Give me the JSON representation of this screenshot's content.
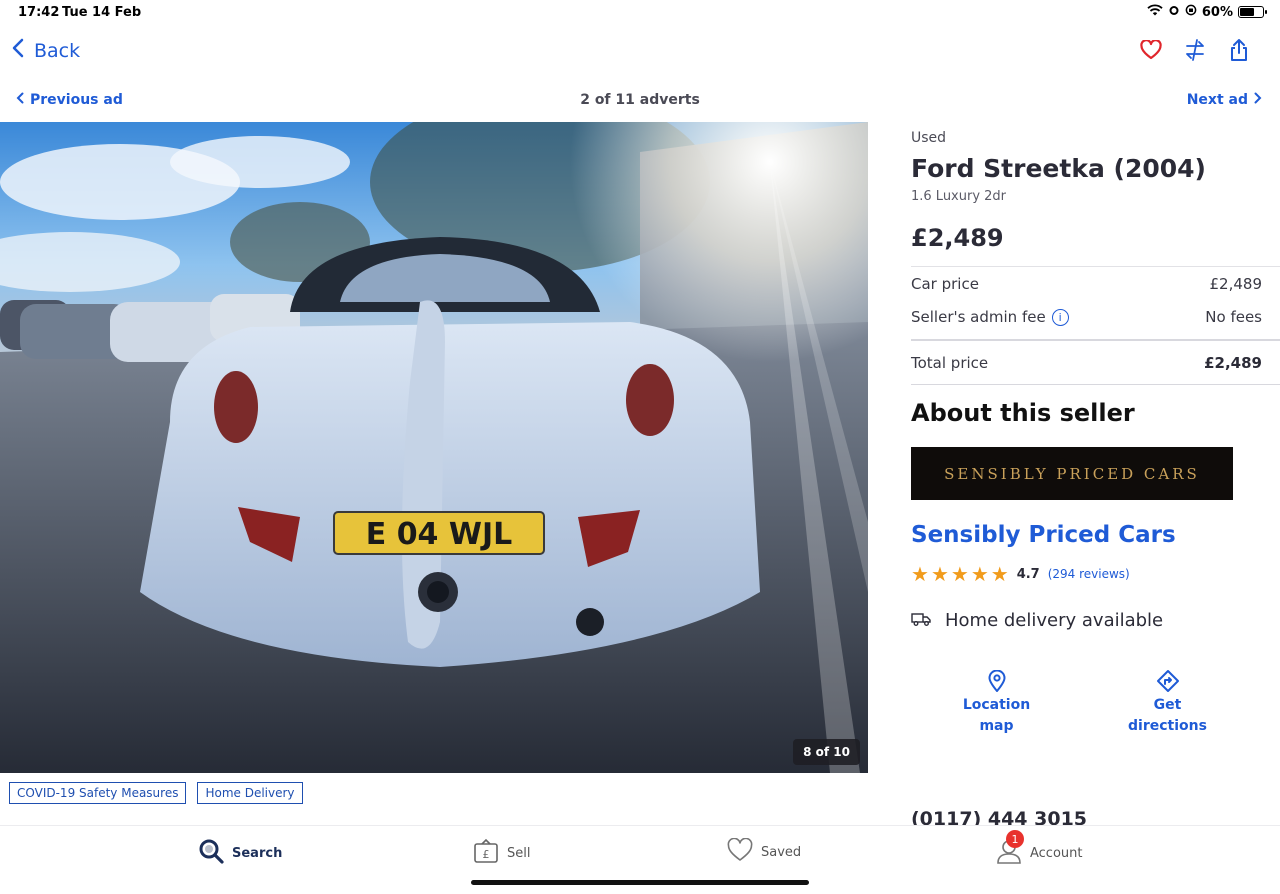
{
  "status_bar": {
    "time": "17:42",
    "date": "Tue 14 Feb",
    "battery": "60%"
  },
  "nav": {
    "back_label": "Back"
  },
  "advert_nav": {
    "prev_label": "Previous ad",
    "count": "2 of 11 adverts",
    "next_label": "Next ad"
  },
  "gallery": {
    "counter": "8 of 10",
    "plate": "E 04 WJL"
  },
  "tags": [
    "COVID-19 Safety Measures",
    "Home Delivery"
  ],
  "listing": {
    "condition": "Used",
    "title": "Ford Streetka (2004)",
    "subtitle": "1.6 Luxury 2dr",
    "price": "£2,489"
  },
  "price_breakdown": {
    "car_price_label": "Car price",
    "car_price": "£2,489",
    "admin_fee_label": "Seller's admin fee",
    "admin_fee": "No fees",
    "total_label": "Total price",
    "total": "£2,489"
  },
  "seller": {
    "heading": "About this seller",
    "logo_text": "SENSIBLY PRICED CARS",
    "name": "Sensibly Priced Cars",
    "rating": "4.7",
    "rating_value": 4.7,
    "reviews": "(294 reviews)",
    "delivery": "Home delivery available",
    "location_label": "Location map",
    "directions_label": "Get directions",
    "phone": "(0117) 444 3015"
  },
  "tab_bar": {
    "search": "Search",
    "sell": "Sell",
    "saved": "Saved",
    "account": "Account",
    "account_badge": "1"
  },
  "colors": {
    "accent": "#1f5bd6",
    "heart": "#e0262c",
    "star": "#f19b1b"
  }
}
